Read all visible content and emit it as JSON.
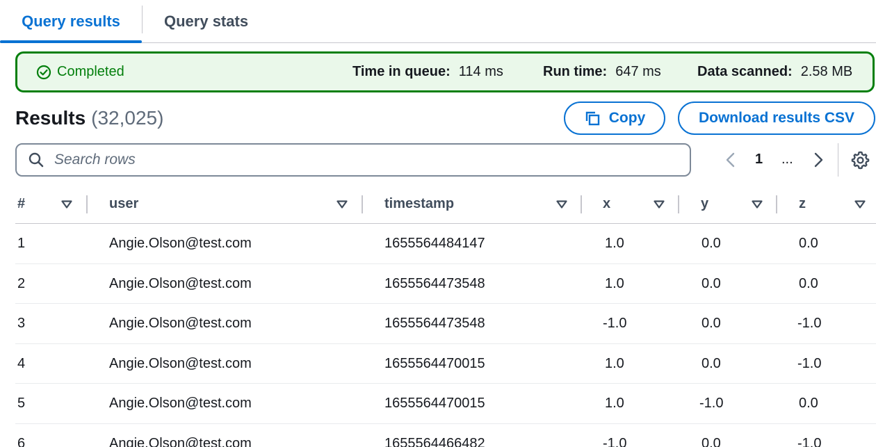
{
  "tabs": {
    "results": "Query results",
    "stats": "Query stats"
  },
  "status": {
    "state": "Completed",
    "queue_label": "Time in queue:",
    "queue_value": "114 ms",
    "run_label": "Run time:",
    "run_value": "647 ms",
    "scan_label": "Data scanned:",
    "scan_value": "2.58 MB",
    "color": "#037f0c"
  },
  "results": {
    "title": "Results",
    "count": "(32,025)",
    "copy_label": "Copy",
    "download_label": "Download results CSV"
  },
  "search": {
    "placeholder": "Search rows"
  },
  "pagination": {
    "current": "1",
    "ellipsis": "..."
  },
  "table": {
    "columns": [
      "#",
      "user",
      "timestamp",
      "x",
      "y",
      "z"
    ],
    "rows": [
      [
        "1",
        "Angie.Olson@test.com",
        "1655564484147",
        "1.0",
        "0.0",
        "0.0"
      ],
      [
        "2",
        "Angie.Olson@test.com",
        "1655564473548",
        "1.0",
        "0.0",
        "0.0"
      ],
      [
        "3",
        "Angie.Olson@test.com",
        "1655564473548",
        "-1.0",
        "0.0",
        "-1.0"
      ],
      [
        "4",
        "Angie.Olson@test.com",
        "1655564470015",
        "1.0",
        "0.0",
        "-1.0"
      ],
      [
        "5",
        "Angie.Olson@test.com",
        "1655564470015",
        "1.0",
        "-1.0",
        "0.0"
      ],
      [
        "6",
        "Angie.Olson@test.com",
        "1655564466482",
        "-1.0",
        "0.0",
        "-1.0"
      ]
    ]
  },
  "colors": {
    "accent": "#0972d3",
    "success": "#037f0c",
    "success_bg": "#eaf8ea"
  }
}
